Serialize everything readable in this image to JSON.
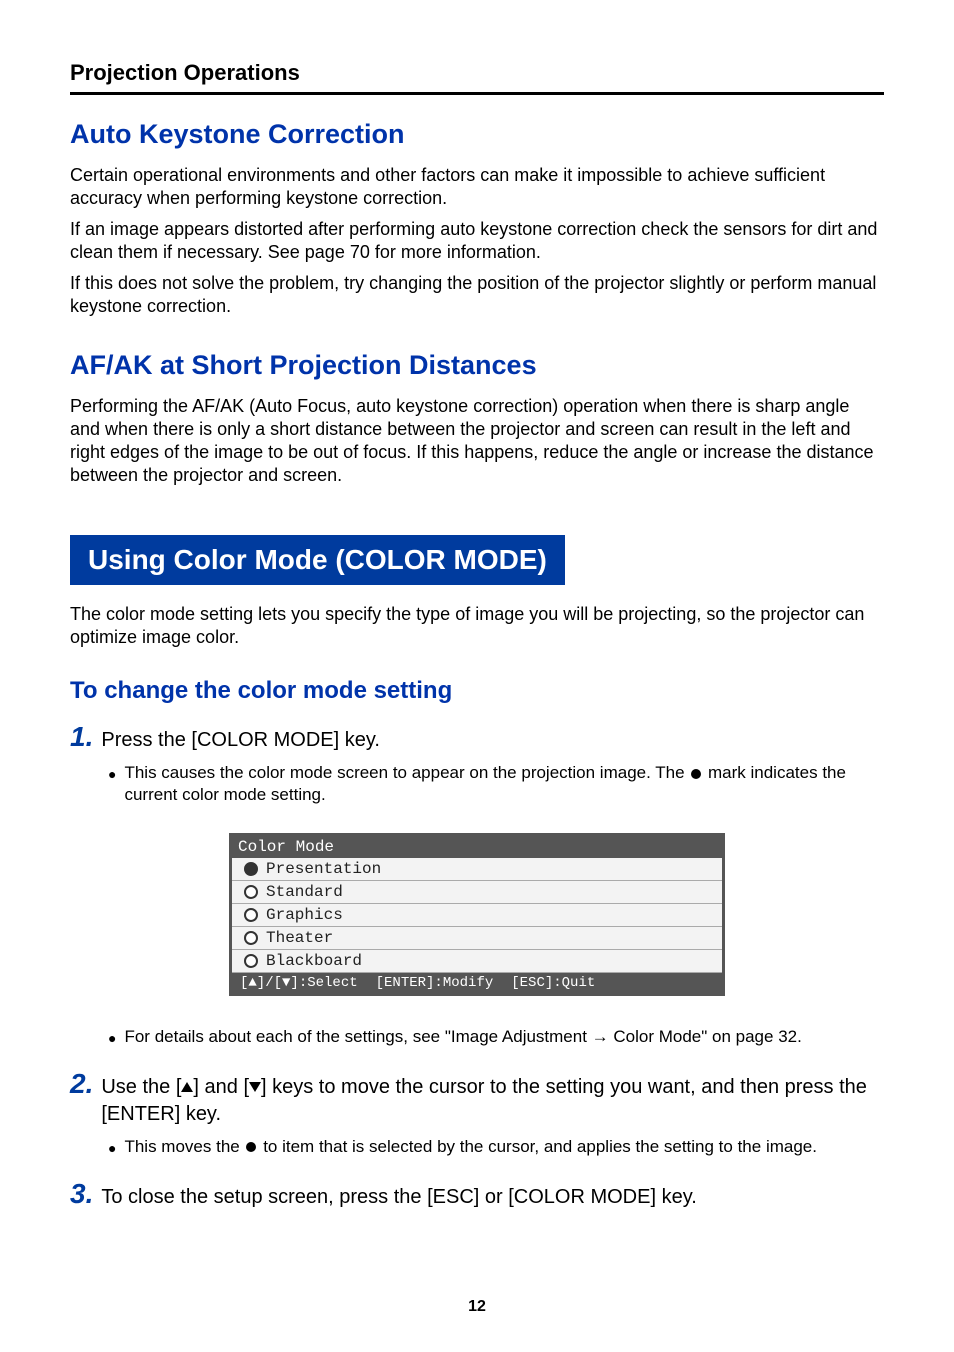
{
  "header": {
    "section": "Projection Operations"
  },
  "h1": "Auto Keystone Correction",
  "p1": "Certain operational environments and other factors can make it impossible to achieve sufficient accuracy when performing keystone correction.",
  "p1b": "If an image appears distorted after performing auto keystone correction check the sensors for dirt and clean them if necessary. See page 70 for more information.",
  "p1c": "If this does not solve the problem, try changing the position of the projector slightly or perform manual keystone correction.",
  "h2": "AF/AK at Short Projection Distances",
  "p2": "Performing the AF/AK (Auto Focus, auto keystone correction) operation when there is sharp angle and when there is only a short distance between the projector and screen can result in the left and right edges of the image to be out of focus. If this happens, reduce the angle or increase the distance between the projector and screen.",
  "boxTitle": "Using Color Mode (COLOR MODE)",
  "boxDesc": "The color mode setting lets you specify the type of image you will be projecting, so the projector can optimize image color.",
  "h3": "To change the color mode setting",
  "step1": {
    "num": "1.",
    "text": "Press the [COLOR MODE] key.",
    "bullet_a": "This causes the color mode screen to appear on the projection image. The ",
    "bullet_b": " mark indicates the current color mode setting.",
    "bullet_details": "For details about each of the settings, see \"Image Adjustment → Color Mode\" on page 32."
  },
  "menu": {
    "title": "Color Mode",
    "items": [
      "Presentation",
      "Standard",
      "Graphics",
      "Theater",
      "Blackboard"
    ],
    "selectedIndex": 0,
    "footer": {
      "select_label": ":Select",
      "modify_label": "[ENTER]:Modify",
      "quit_label": "[ESC]:Quit"
    }
  },
  "step2": {
    "num": "2.",
    "text_a": "Use the [",
    "text_mid": "] and [",
    "text_b": "] keys to move the cursor to the setting you want, and then press the [ENTER] key.",
    "bullet_a": "This moves the ",
    "bullet_b": " to item that is selected by the cursor, and applies the setting to the image."
  },
  "step3": {
    "num": "3.",
    "text": "To close the setup screen, press the [ESC] or [COLOR MODE] key."
  },
  "pageNumber": "12"
}
